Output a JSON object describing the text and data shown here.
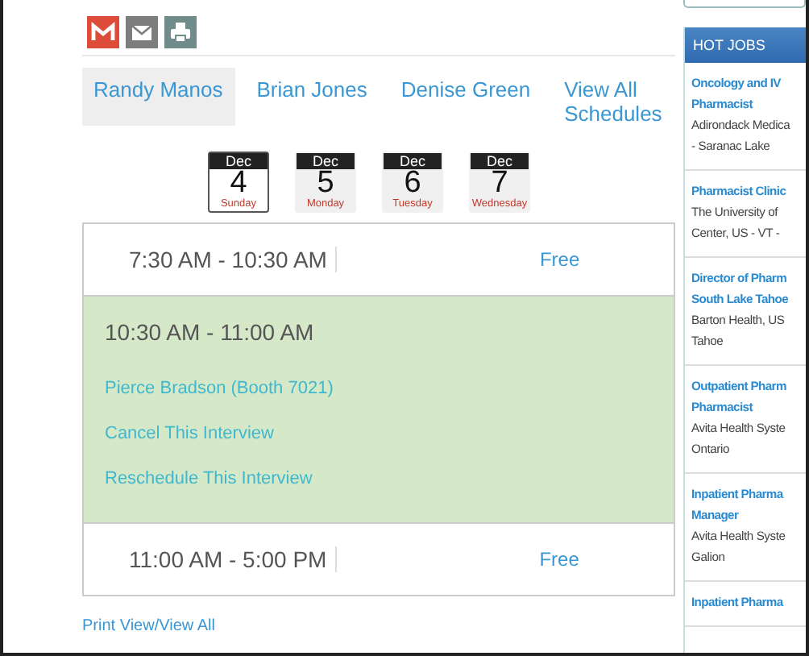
{
  "share_icons": [
    {
      "kind": "gmail"
    },
    {
      "kind": "email"
    },
    {
      "kind": "print"
    }
  ],
  "tabs": [
    {
      "label": "Randy Manos",
      "selected": true
    },
    {
      "label": "Brian Jones",
      "selected": false
    },
    {
      "label": "Denise Green",
      "selected": false
    },
    {
      "label": "View All Schedules",
      "selected": false
    }
  ],
  "dates": [
    {
      "month": "Dec",
      "day": "4",
      "weekday": "Sunday",
      "selected": true
    },
    {
      "month": "Dec",
      "day": "5",
      "weekday": "Monday",
      "selected": false
    },
    {
      "month": "Dec",
      "day": "6",
      "weekday": "Tuesday",
      "selected": false
    },
    {
      "month": "Dec",
      "day": "7",
      "weekday": "Wednesday",
      "selected": false
    }
  ],
  "slots": [
    {
      "kind": "free",
      "time": "7:30 AM - 10:30 AM",
      "status": "Free"
    },
    {
      "kind": "booked",
      "time": "10:30 AM - 11:00 AM",
      "links": [
        "Pierce Bradson (Booth 7021)",
        "Cancel This Interview",
        "Reschedule This Interview"
      ]
    },
    {
      "kind": "free",
      "time": "11:00 AM - 5:00 PM",
      "status": "Free"
    }
  ],
  "print_link": "Print View/View All",
  "hot_jobs": {
    "title": "HOT JOBS",
    "jobs": [
      {
        "title_lines": [
          "Oncology and IV",
          "Pharmacist"
        ],
        "org_lines": [
          "Adirondack Medica",
          "- Saranac Lake"
        ]
      },
      {
        "title_lines": [
          "Pharmacist Clinic"
        ],
        "org_lines": [
          "The University of",
          "Center, US - VT -"
        ]
      },
      {
        "title_lines": [
          "Director of Pharm",
          "South Lake Tahoe"
        ],
        "org_lines": [
          "Barton Health, US",
          "Tahoe"
        ]
      },
      {
        "title_lines": [
          "Outpatient Pharm",
          "Pharmacist"
        ],
        "org_lines": [
          "Avita Health Syste",
          "Ontario"
        ]
      },
      {
        "title_lines": [
          "Inpatient Pharma",
          "Manager"
        ],
        "org_lines": [
          "Avita Health Syste",
          "Galion"
        ]
      },
      {
        "title_lines": [
          "Inpatient Pharma"
        ]
      }
    ]
  }
}
